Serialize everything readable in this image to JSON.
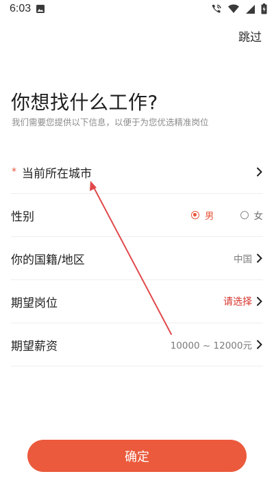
{
  "status_bar": {
    "time": "6:03",
    "left_icon": "image-icon",
    "right_icons": [
      "wifi-calling-icon",
      "wifi-icon",
      "signal-icon",
      "battery-charging-icon"
    ]
  },
  "header": {
    "skip_label": "跳过"
  },
  "intro": {
    "title": "你想找什么工作?",
    "subtitle": "我们需要您提供以下信息，以便于为您优选精准岗位"
  },
  "form": {
    "rows": [
      {
        "required_mark": "*",
        "label": "当前所在城市",
        "value": ""
      },
      {
        "label": "性别",
        "options": [
          "男",
          "女"
        ],
        "selected": "男"
      },
      {
        "label": "你的国籍/地区",
        "value": "中国"
      },
      {
        "label": "期望岗位",
        "value": "请选择"
      },
      {
        "label": "期望薪资",
        "value": "10000 ~ 12000元"
      }
    ]
  },
  "footer": {
    "confirm_label": "确定"
  },
  "colors": {
    "accent": "#eb5a3c",
    "required": "#e5533a",
    "placeholder_red": "#d7322b",
    "annotation_arrow": "#e0484b"
  }
}
